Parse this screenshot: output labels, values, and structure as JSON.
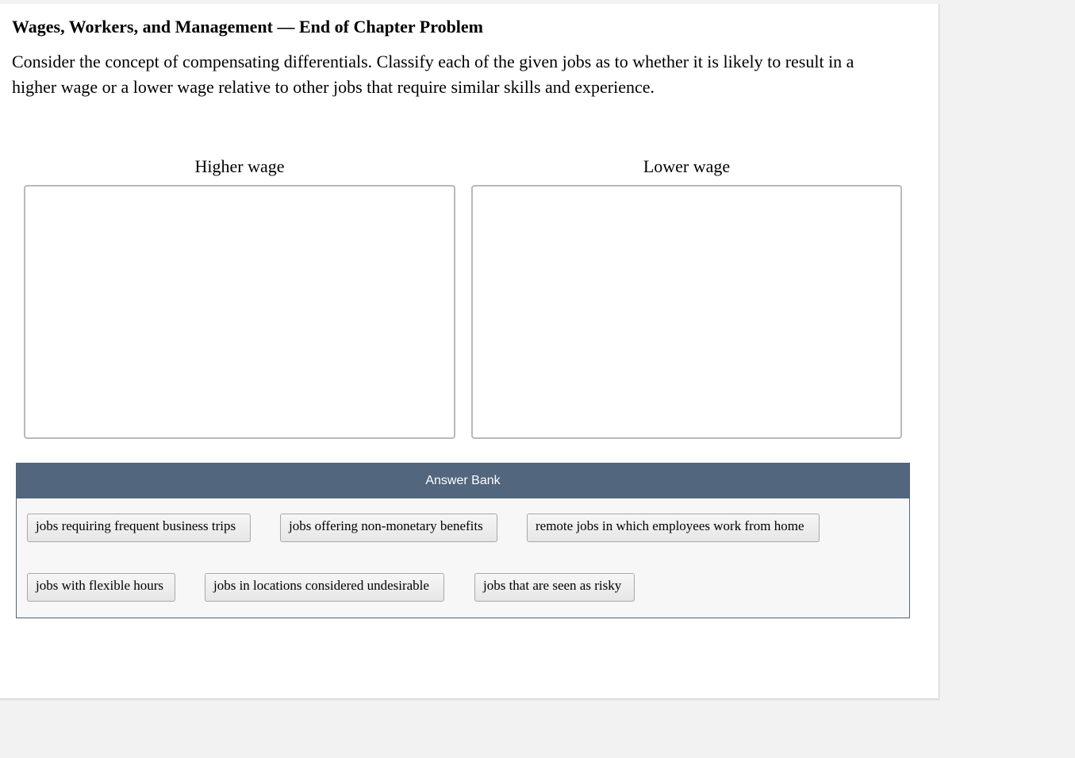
{
  "question": {
    "title": "Wages, Workers, and Management — End of Chapter Problem",
    "prompt": "Consider the concept of compensating differentials. Classify each of the given jobs as to whether it is likely to result in a higher wage or a lower wage relative to other jobs that require similar skills and experience."
  },
  "bins": {
    "higher": {
      "label": "Higher wage"
    },
    "lower": {
      "label": "Lower wage"
    }
  },
  "answer_bank": {
    "header": "Answer Bank",
    "items": [
      "jobs requiring frequent business trips",
      "jobs offering non-monetary benefits",
      "remote jobs in which employees work from home",
      "jobs with flexible hours",
      "jobs in locations considered undesirable",
      "jobs that are seen as risky"
    ]
  },
  "colors": {
    "answer_bank_header_bg": "#52667d",
    "page_bg": "#f2f2f2",
    "panel_bg": "#ffffff"
  }
}
